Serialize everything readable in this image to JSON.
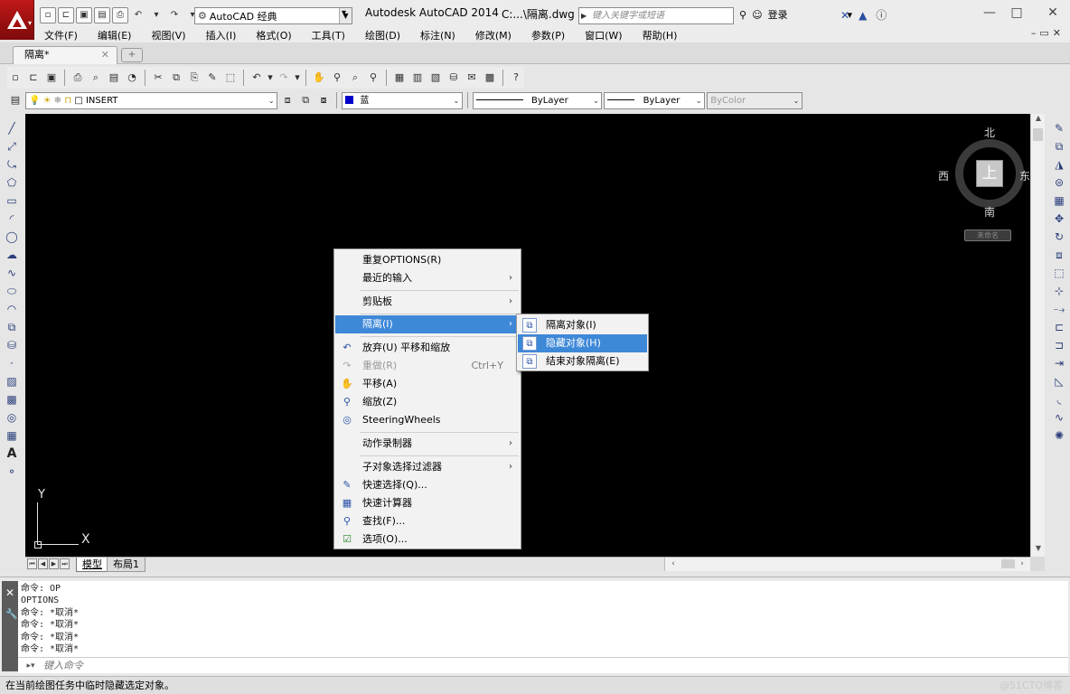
{
  "title_bar": {
    "workspace": "AutoCAD 经典",
    "app_title": "Autodesk AutoCAD 2014",
    "doc_title": "C:...\\隔离.dwg",
    "search_placeholder": "键入关键字或短语",
    "login_label": "登录"
  },
  "menubar": {
    "items": [
      "文件(F)",
      "编辑(E)",
      "视图(V)",
      "插入(I)",
      "格式(O)",
      "工具(T)",
      "绘图(D)",
      "标注(N)",
      "修改(M)",
      "参数(P)",
      "窗口(W)",
      "帮助(H)"
    ]
  },
  "document_tab": {
    "label": "隔离*"
  },
  "layer_toolbar": {
    "layer_name": "INSERT",
    "color": "蓝",
    "color_hex": "#0000c8",
    "linetype": "ByLayer",
    "lineweight": "ByLayer",
    "plotstyle": "ByColor"
  },
  "viewcube": {
    "north": "北",
    "south": "南",
    "east": "东",
    "west": "西",
    "face": "上",
    "wcs": "未命名"
  },
  "ucs": {
    "x": "X",
    "y": "Y"
  },
  "context_menu": {
    "items": [
      {
        "label": "重复OPTIONS(R)"
      },
      {
        "label": "最近的输入"
      },
      {
        "label": "剪贴板"
      },
      {
        "label": "隔离(I)"
      },
      {
        "label": "放弃(U) 平移和缩放"
      },
      {
        "label": "重做(R)",
        "shortcut": "Ctrl+Y"
      },
      {
        "label": "平移(A)"
      },
      {
        "label": "缩放(Z)"
      },
      {
        "label": "SteeringWheels"
      },
      {
        "label": "动作录制器"
      },
      {
        "label": "子对象选择过滤器"
      },
      {
        "label": "快速选择(Q)..."
      },
      {
        "label": "快速计算器"
      },
      {
        "label": "查找(F)..."
      },
      {
        "label": "选项(O)..."
      }
    ]
  },
  "submenu": {
    "items": [
      {
        "label": "隔离对象(I)"
      },
      {
        "label": "隐藏对象(H)"
      },
      {
        "label": "结束对象隔离(E)"
      }
    ]
  },
  "layout_tabs": {
    "model": "模型",
    "layout1": "布局1"
  },
  "command_history": [
    "命令: OP",
    "OPTIONS",
    "命令: *取消*",
    "命令: *取消*",
    "命令: *取消*",
    "命令: *取消*"
  ],
  "command_input": {
    "placeholder": "键入命令"
  },
  "status_text": "在当前绘图任务中临时隐藏选定对象。",
  "watermark": "@51CTO博客"
}
